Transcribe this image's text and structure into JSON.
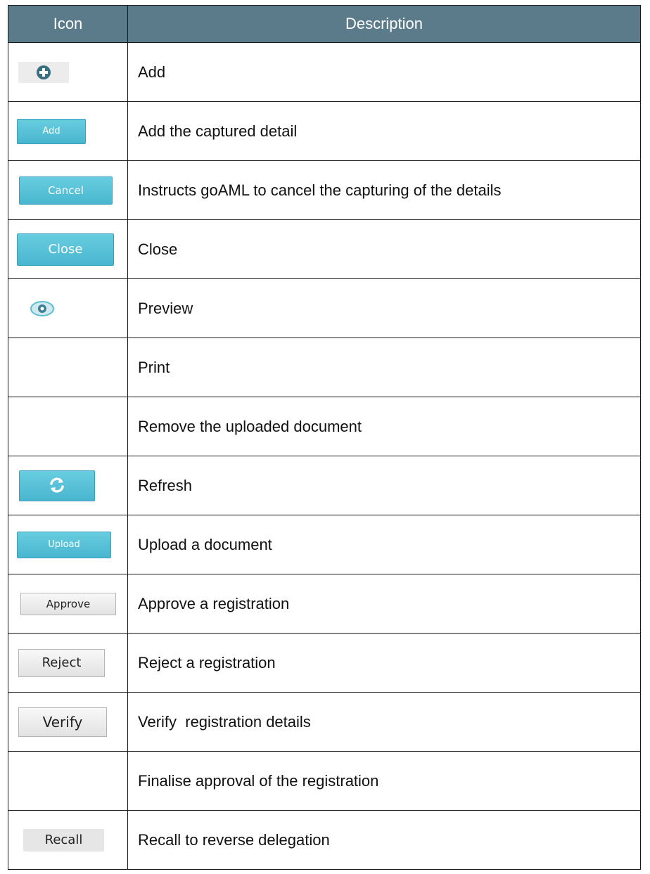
{
  "table": {
    "headers": {
      "icon": "Icon",
      "description": "Description"
    },
    "rows": [
      {
        "icon": "add-circle-icon",
        "button_label": "",
        "description": "Add"
      },
      {
        "icon": "add-button",
        "button_label": "Add",
        "description": "Add the captured detail"
      },
      {
        "icon": "cancel-button",
        "button_label": "Cancel",
        "description": "Instructs goAML to cancel the capturing of the details"
      },
      {
        "icon": "close-button",
        "button_label": "Close",
        "description": "Close"
      },
      {
        "icon": "eye-icon",
        "button_label": "",
        "description": "Preview"
      },
      {
        "icon": "",
        "button_label": "",
        "description": "Print"
      },
      {
        "icon": "",
        "button_label": "",
        "description": "Remove the uploaded document"
      },
      {
        "icon": "refresh-icon",
        "button_label": "",
        "description": "Refresh"
      },
      {
        "icon": "upload-button",
        "button_label": "Upload",
        "description": "Upload a document"
      },
      {
        "icon": "approve-button",
        "button_label": "Approve",
        "description": "Approve a registration"
      },
      {
        "icon": "reject-button",
        "button_label": "Reject",
        "description": "Reject a registration"
      },
      {
        "icon": "verify-button",
        "button_label": "Verify",
        "description": "Verify  registration details"
      },
      {
        "icon": "",
        "button_label": "",
        "description": "Finalise approval of the registration"
      },
      {
        "icon": "recall-button",
        "button_label": "Recall",
        "description": "Recall to reverse delegation"
      }
    ]
  },
  "colors": {
    "header_bg": "#5b7b8a",
    "cyan_button": "#5bc3d8",
    "icon_dark": "#3a6f82"
  }
}
